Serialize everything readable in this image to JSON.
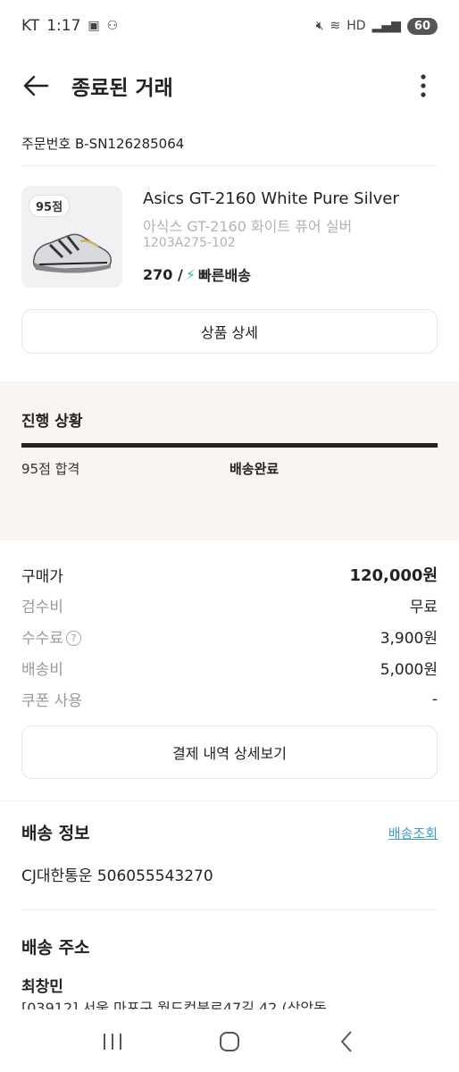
{
  "status_bar": {
    "carrier": "KT",
    "time": "1:17",
    "battery": "60"
  },
  "header": {
    "title": "종료된 거래"
  },
  "order": {
    "number": "주문번호 B-SN126285064"
  },
  "product": {
    "grade_badge": "95점",
    "name_en": "Asics GT-2160 White Pure Silver",
    "name_ko": "아식스 GT-2160 화이트 퓨어 실버",
    "code": "1203A275-102",
    "size": "270 /",
    "shipping_type": "빠른배송",
    "detail_button": "상품 상세"
  },
  "progress": {
    "title": "진행 상황",
    "steps": [
      "95점 합격",
      "배송완료"
    ],
    "progress_fraction": 1.0
  },
  "payment": {
    "rows": [
      {
        "label": "구매가",
        "value": "120,000원"
      },
      {
        "label": "검수비",
        "value": "무료"
      },
      {
        "label": "수수료",
        "value": "3,900원"
      },
      {
        "label": "배송비",
        "value": "5,000원"
      },
      {
        "label": "쿠폰 사용",
        "value": "-"
      }
    ],
    "detail_button": "결제 내역 상세보기"
  },
  "shipping": {
    "title": "배송 정보",
    "track_link": "배송조회",
    "tracking": "CJ대한통운 506055543270"
  },
  "address": {
    "title": "배송 주소",
    "name": "최창민",
    "line": "[03912] 서울 마포구 월드컵북로47길 42 (상암동"
  },
  "colors": {
    "accent_link": "#3d9dcc",
    "progress_bg": "#fbf5f1",
    "bolt": "#2fbf71"
  }
}
